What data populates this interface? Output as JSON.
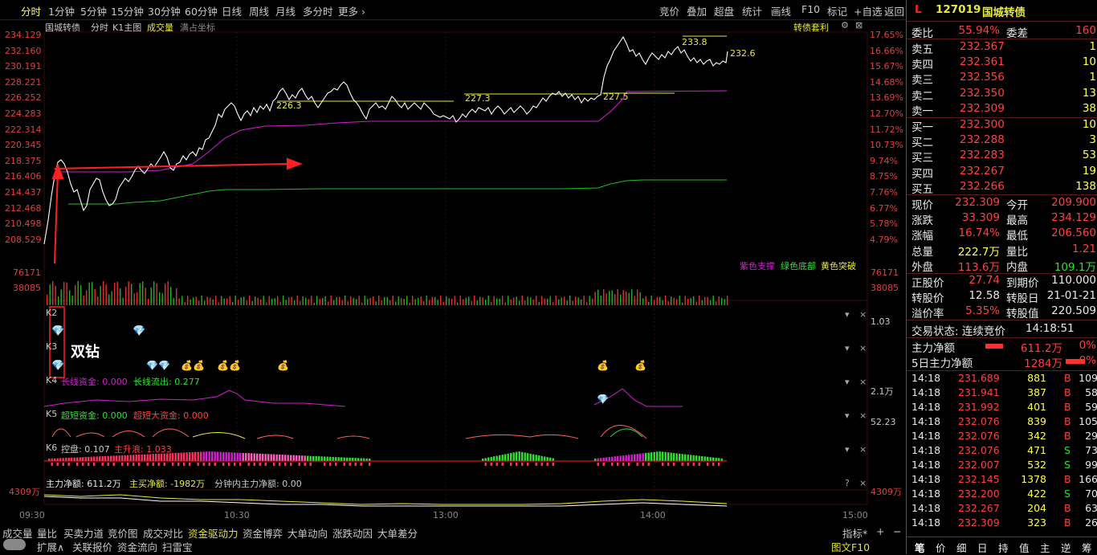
{
  "toolbar": {
    "periods": [
      "分时",
      "1分钟",
      "5分钟",
      "15分钟",
      "30分钟",
      "60分钟",
      "日线",
      "周线",
      "月线",
      "多分时",
      "更多"
    ],
    "active_period": "分时",
    "right_items": [
      "竞价",
      "叠加",
      "超盘",
      "统计",
      "画线",
      "F10",
      "标记",
      "+自选",
      "返回"
    ]
  },
  "chart": {
    "header": {
      "name": "国城转债",
      "mode": "分时",
      "k1": "K1主图",
      "vol": "成交量",
      "full": "满占坐标",
      "arb": "转债套利"
    },
    "left_axis": [
      "234.129",
      "232.160",
      "230.191",
      "228.221",
      "226.252",
      "224.283",
      "222.314",
      "220.345",
      "218.375",
      "216.406",
      "214.437",
      "212.468",
      "210.498",
      "208.529"
    ],
    "right_axis": [
      "17.65%",
      "16.66%",
      "15.67%",
      "14.68%",
      "13.69%",
      "12.70%",
      "11.72%",
      "10.73%",
      "9.74%",
      "8.75%",
      "7.76%",
      "6.77%",
      "5.78%",
      "4.79%"
    ],
    "vol_labels": [
      "76171",
      "38085"
    ],
    "annotations": [
      "226.3",
      "227.3",
      "227.5",
      "233.8",
      "232.6"
    ],
    "legend": {
      "purple": "紫色支撑",
      "green": "绿色底部",
      "yellow": "黄色突破"
    },
    "double_diamond": "双钻",
    "k2": "K2",
    "k2_val": "1.03",
    "k3": "K3",
    "k4": {
      "label": "K4",
      "a": "长线资金: 0.000",
      "b": "长线流出: 0.277",
      "val": "2.1万"
    },
    "k5": {
      "label": "K5",
      "a": "超短资金: 0.000",
      "b": "超短大资金: 0.000",
      "val": "52.23"
    },
    "k6": {
      "label": "K6",
      "a": "控盘: 0.107",
      "b": "主升浪: 1.033"
    },
    "flow": {
      "a": "主力净额: 611.2万",
      "b": "主买净额: -1982万",
      "c": "分钟内主力净额: 0.00",
      "left": "4309万",
      "right": "4309万"
    },
    "time_axis": [
      "09:30",
      "10:30",
      "13:00",
      "14:00",
      "15:00"
    ],
    "colors": {
      "price": "#ffffff",
      "purple": "#d020d0",
      "green": "#20c020",
      "yellow": "#e8e840",
      "arrow": "#ff2020"
    }
  },
  "right_panel": {
    "code": "127019",
    "name": "国城转债",
    "wb": {
      "label": "委比",
      "val": "55.94%",
      "label2": "委差",
      "val2": "160"
    },
    "asks": [
      {
        "label": "卖五",
        "price": "232.367",
        "vol": "1"
      },
      {
        "label": "卖四",
        "price": "232.361",
        "vol": "10"
      },
      {
        "label": "卖三",
        "price": "232.356",
        "vol": "1"
      },
      {
        "label": "卖二",
        "price": "232.350",
        "vol": "13"
      },
      {
        "label": "卖一",
        "price": "232.309",
        "vol": "38"
      }
    ],
    "bids": [
      {
        "label": "买一",
        "price": "232.300",
        "vol": "10"
      },
      {
        "label": "买二",
        "price": "232.288",
        "vol": "3"
      },
      {
        "label": "买三",
        "price": "232.283",
        "vol": "53"
      },
      {
        "label": "买四",
        "price": "232.267",
        "vol": "19"
      },
      {
        "label": "买五",
        "price": "232.266",
        "vol": "138"
      }
    ],
    "stats": [
      {
        "l1": "现价",
        "v1": "232.309",
        "l2": "今开",
        "v2": "209.900",
        "c1": "red",
        "c2": "red"
      },
      {
        "l1": "涨跌",
        "v1": "33.309",
        "l2": "最高",
        "v2": "234.129",
        "c1": "red",
        "c2": "red"
      },
      {
        "l1": "涨幅",
        "v1": "16.74%",
        "l2": "最低",
        "v2": "206.560",
        "c1": "red",
        "c2": "red"
      },
      {
        "l1": "总量",
        "v1": "222.7万",
        "l2": "量比",
        "v2": "1.21",
        "c1": "yellow",
        "c2": "red"
      },
      {
        "l1": "外盘",
        "v1": "113.6万",
        "l2": "内盘",
        "v2": "109.1万",
        "c1": "red",
        "c2": "green"
      }
    ],
    "bond": [
      {
        "l1": "正股价",
        "v1": "27.74",
        "l2": "到期价",
        "v2": "110.000",
        "c1": "red",
        "c2": "white"
      },
      {
        "l1": "转股价",
        "v1": "12.58",
        "l2": "转股日",
        "v2": "21-01-21",
        "c1": "white",
        "c2": "white"
      },
      {
        "l1": "溢价率",
        "v1": "5.35%",
        "l2": "转股值",
        "v2": "220.509",
        "c1": "red",
        "c2": "white"
      }
    ],
    "trade_status": {
      "label": "交易状态: 连续竞价",
      "time": "14:18:51"
    },
    "main_net": {
      "label": "主力净额",
      "val": "611.2万",
      "pct": "0%"
    },
    "five_day": {
      "label": "5日主力净额",
      "val": "1284万",
      "pct": "0%"
    },
    "ticks": [
      {
        "t": "14:18",
        "p": "231.689",
        "v": "881",
        "s": "B",
        "n": "109"
      },
      {
        "t": "14:18",
        "p": "231.941",
        "v": "387",
        "s": "B",
        "n": "58"
      },
      {
        "t": "14:18",
        "p": "231.992",
        "v": "401",
        "s": "B",
        "n": "59"
      },
      {
        "t": "14:18",
        "p": "232.076",
        "v": "839",
        "s": "B",
        "n": "105"
      },
      {
        "t": "14:18",
        "p": "232.076",
        "v": "342",
        "s": "B",
        "n": "29"
      },
      {
        "t": "14:18",
        "p": "232.076",
        "v": "471",
        "s": "S",
        "n": "73"
      },
      {
        "t": "14:18",
        "p": "232.007",
        "v": "532",
        "s": "S",
        "n": "99"
      },
      {
        "t": "14:18",
        "p": "232.145",
        "v": "1378",
        "s": "B",
        "n": "166"
      },
      {
        "t": "14:18",
        "p": "232.200",
        "v": "422",
        "s": "S",
        "n": "70"
      },
      {
        "t": "14:18",
        "p": "232.267",
        "v": "204",
        "s": "B",
        "n": "63"
      },
      {
        "t": "14:18",
        "p": "232.309",
        "v": "323",
        "s": "B",
        "n": "26"
      }
    ],
    "bottom_tabs": [
      "笔",
      "价",
      "细",
      "日",
      "持",
      "值",
      "主",
      "逆",
      "筹"
    ]
  },
  "bottom": {
    "row1": [
      "成交量",
      "量比",
      "买卖力道",
      "竞价图",
      "成交对比",
      "资金驱动力",
      "资金博弈",
      "大单动向",
      "涨跌动因",
      "大单差分"
    ],
    "active": "资金驱动力",
    "indicator": "指标",
    "row2": [
      "扩展∧",
      "关联报价",
      "资金流向",
      "扫雷宝"
    ],
    "f10": "图文F10"
  }
}
